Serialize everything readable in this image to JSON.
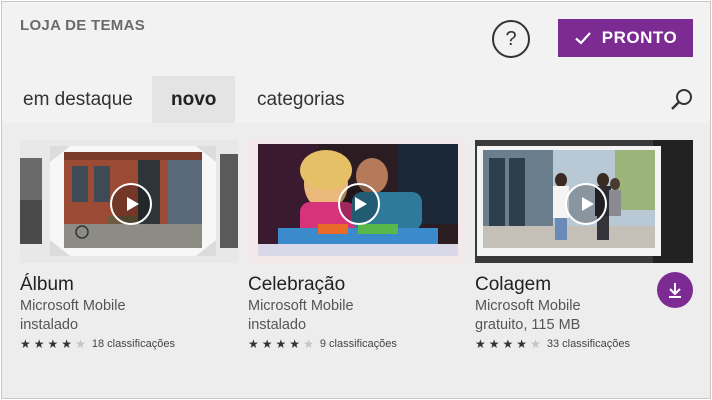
{
  "header": {
    "title": "LOJA DE TEMAS",
    "help_label": "?",
    "done_label": "PRONTO"
  },
  "tabs": [
    {
      "label": "em destaque",
      "active": false
    },
    {
      "label": "novo",
      "active": true
    },
    {
      "label": "categorias",
      "active": false
    }
  ],
  "icons": {
    "search": "search-icon",
    "check": "checkmark-icon",
    "play": "play-icon",
    "download": "download-icon"
  },
  "colors": {
    "accent": "#7c2b93",
    "background": "#f2f2f2"
  },
  "themes": [
    {
      "name": "Álbum",
      "publisher": "Microsoft Mobile",
      "status": "instalado",
      "stars": 4,
      "ratings": "18 classificações"
    },
    {
      "name": "Celebração",
      "publisher": "Microsoft Mobile",
      "status": "instalado",
      "stars": 4,
      "ratings": "9 classificações"
    },
    {
      "name": "Colagem",
      "publisher": "Microsoft Mobile",
      "status": "gratuito, 115 MB",
      "stars": 4,
      "ratings": "33 classificações"
    }
  ]
}
